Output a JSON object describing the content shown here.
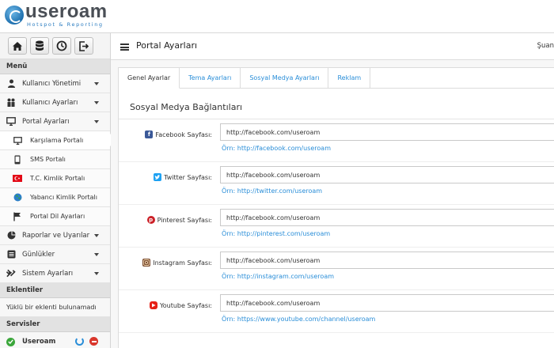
{
  "brand": {
    "name": "useroam",
    "tagline": "Hotspot & Reporting"
  },
  "header": {
    "title": "Portal Ayarları",
    "user": "Şuan"
  },
  "sidebar": {
    "shortcuts": [
      "home-icon",
      "database-icon",
      "clock-icon",
      "logout-icon"
    ],
    "menu_title": "Menü",
    "items": [
      {
        "label": "Kullanıcı Yönetimi",
        "icon": "user-icon"
      },
      {
        "label": "Kullanıcı Ayarları",
        "icon": "users-icon"
      },
      {
        "label": "Portal Ayarları",
        "icon": "monitor-icon"
      }
    ],
    "sub_items": [
      {
        "label": "Karşılama Portalı",
        "icon": "monitor-icon"
      },
      {
        "label": "SMS Portalı",
        "icon": "phone-icon"
      },
      {
        "label": "T.C. Kimlik Portalı",
        "icon": "turkey-flag-icon"
      },
      {
        "label": "Yabancı Kimlik Portalı",
        "icon": "globe-icon"
      },
      {
        "label": "Portal Dil Ayarları",
        "icon": "flag-icon"
      }
    ],
    "items_after": [
      {
        "label": "Raporlar ve Uyarılar",
        "icon": "pie-chart-icon"
      },
      {
        "label": "Günlükler",
        "icon": "log-icon"
      },
      {
        "label": "Sistem Ayarları",
        "icon": "tools-icon"
      }
    ],
    "plugins_title": "Eklentiler",
    "plugins_empty": "Yüklü bir eklenti bulunamadı",
    "services_title": "Servisler",
    "service_name": "Useroam"
  },
  "tabs": [
    "Genel Ayarlar",
    "Tema Ayarları",
    "Sosyal Medya Ayarları",
    "Reklam"
  ],
  "section_title": "Sosyal Medya Bağlantıları",
  "fields": [
    {
      "label": "Facebook Sayfası:",
      "icon": "facebook-icon",
      "value": "http://facebook.com/useroam",
      "hint": "Örn: http://facebook.com/useroam",
      "color": "#3b5998"
    },
    {
      "label": "Twitter Sayfası:",
      "icon": "twitter-icon",
      "value": "http://facebook.com/useroam",
      "hint": "Örn: http://twitter.com/useroam",
      "color": "#1da1f2"
    },
    {
      "label": "Pinterest Sayfası:",
      "icon": "pinterest-icon",
      "value": "http://facebook.com/useroam",
      "hint": "Örn: http://pinterest.com/useroam",
      "color": "#cb2027"
    },
    {
      "label": "Instagram Sayfası:",
      "icon": "instagram-icon",
      "value": "http://facebook.com/useroam",
      "hint": "Örn: http://instagram.com/useroam",
      "color": "#7a4a2e"
    },
    {
      "label": "Youtube Sayfası:",
      "icon": "youtube-icon",
      "value": "http://facebook.com/useroam",
      "hint": "Örn: https://www.youtube.com/channel/useroam",
      "color": "#e62117"
    }
  ],
  "colors": {
    "accent": "#2a8ed8",
    "service_ok": "#3aa63a",
    "service_stop": "#d9362b"
  }
}
